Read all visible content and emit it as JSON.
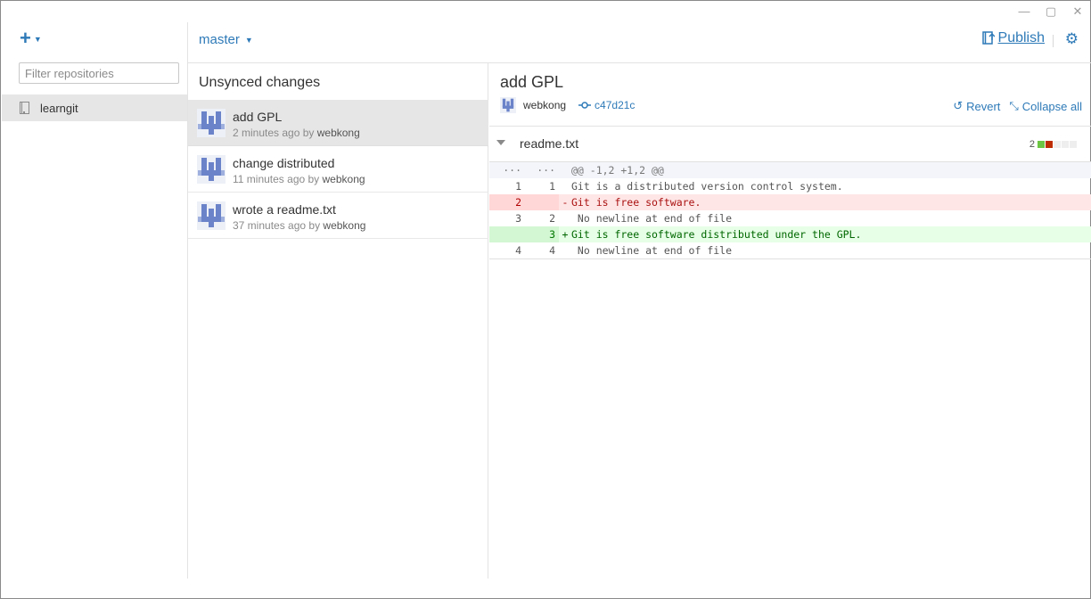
{
  "window": {
    "minimize_glyph": "—",
    "maximize_glyph": "▢",
    "close_glyph": "✕"
  },
  "sidebar": {
    "filter_placeholder": "Filter repositories",
    "repos": [
      {
        "label": "learngit",
        "icon": "book-icon",
        "selected": true
      }
    ]
  },
  "toolbar": {
    "branch_label": "master",
    "publish_label": "Publish"
  },
  "history": {
    "title": "Unsynced changes",
    "commits": [
      {
        "message": "add GPL",
        "time": "2 minutes ago by",
        "author": "webkong",
        "selected": true
      },
      {
        "message": "change distributed",
        "time": "11 minutes ago by",
        "author": "webkong",
        "selected": false
      },
      {
        "message": "wrote a readme.txt",
        "time": "37 minutes ago by",
        "author": "webkong",
        "selected": false
      }
    ]
  },
  "detail": {
    "title": "add GPL",
    "author": "webkong",
    "sha": "c47d21c",
    "revert_label": "Revert",
    "collapse_label": "Collapse all",
    "file": {
      "name": "readme.txt",
      "changes_count": "2",
      "diffstat_colors": [
        "#6cc644",
        "#bd2c00",
        "#e0e0e0",
        "#e0e0e0",
        "#e0e0e0"
      ]
    },
    "diff": [
      {
        "type": "hunk",
        "old": "···",
        "new": "···",
        "sign": "",
        "code": "@@ -1,2 +1,2 @@"
      },
      {
        "type": "ctx",
        "old": "1",
        "new": "1",
        "sign": "",
        "code": "Git is a distributed version control system."
      },
      {
        "type": "del",
        "old": "2",
        "new": "",
        "sign": "-",
        "code": "Git is free software."
      },
      {
        "type": "ctx",
        "old": "3",
        "new": "2",
        "sign": "",
        "code": " No newline at end of file"
      },
      {
        "type": "add",
        "old": "",
        "new": "3",
        "sign": "+",
        "code": "Git is free software distributed under the GPL."
      },
      {
        "type": "ctx",
        "old": "4",
        "new": "4",
        "sign": "",
        "code": " No newline at end of file"
      }
    ]
  },
  "colors": {
    "accent": "#2e7ab8",
    "avatar": "#6b83c8",
    "selected_bg": "#e6e6e6"
  }
}
